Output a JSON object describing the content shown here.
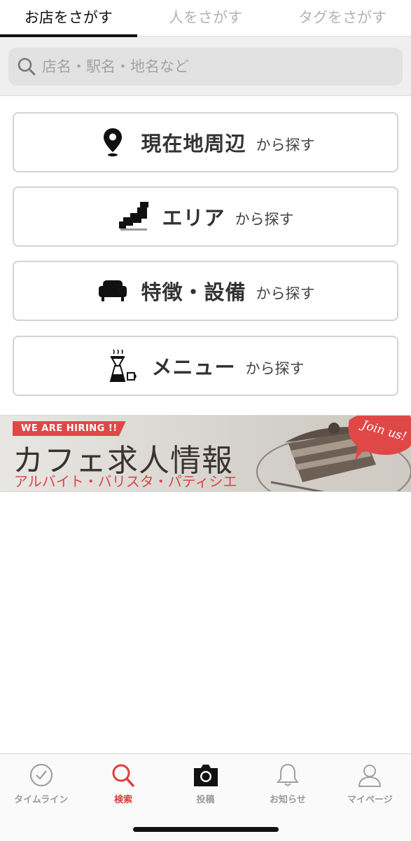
{
  "tabs": [
    {
      "label": "お店をさがす",
      "active": true
    },
    {
      "label": "人をさがす",
      "active": false
    },
    {
      "label": "タグをさがす",
      "active": false
    }
  ],
  "search": {
    "placeholder": "店名・駅名・地名など",
    "value": "",
    "icon": "search-icon"
  },
  "menu_buttons": [
    {
      "icon": "location-pin-icon",
      "label": "現在地周辺",
      "suffix": "から探す"
    },
    {
      "icon": "japan-map-icon",
      "label": "エリア",
      "suffix": "から探す"
    },
    {
      "icon": "sofa-icon",
      "label": "特徴・設備",
      "suffix": "から探す"
    },
    {
      "icon": "coffee-dripper-icon",
      "label": "メニュー",
      "suffix": "から探す"
    }
  ],
  "banner": {
    "badge": "WE ARE HIRING !!",
    "title": "カフェ求人情報",
    "subtitle": "アルバイト・バリスタ・パティシエ",
    "join": "Join us!",
    "accent_color": "#e04848"
  },
  "bottom_nav": [
    {
      "icon": "clock-icon",
      "label": "タイムライン",
      "active": false
    },
    {
      "icon": "search-icon",
      "label": "検索",
      "active": true
    },
    {
      "icon": "camera-icon",
      "label": "投稿",
      "active": false
    },
    {
      "icon": "bell-icon",
      "label": "お知らせ",
      "active": false
    },
    {
      "icon": "person-icon",
      "label": "マイページ",
      "active": false
    }
  ],
  "colors": {
    "active_nav": "#e03c3c",
    "inactive_nav": "#9a9a9a",
    "tab_active": "#111111"
  }
}
